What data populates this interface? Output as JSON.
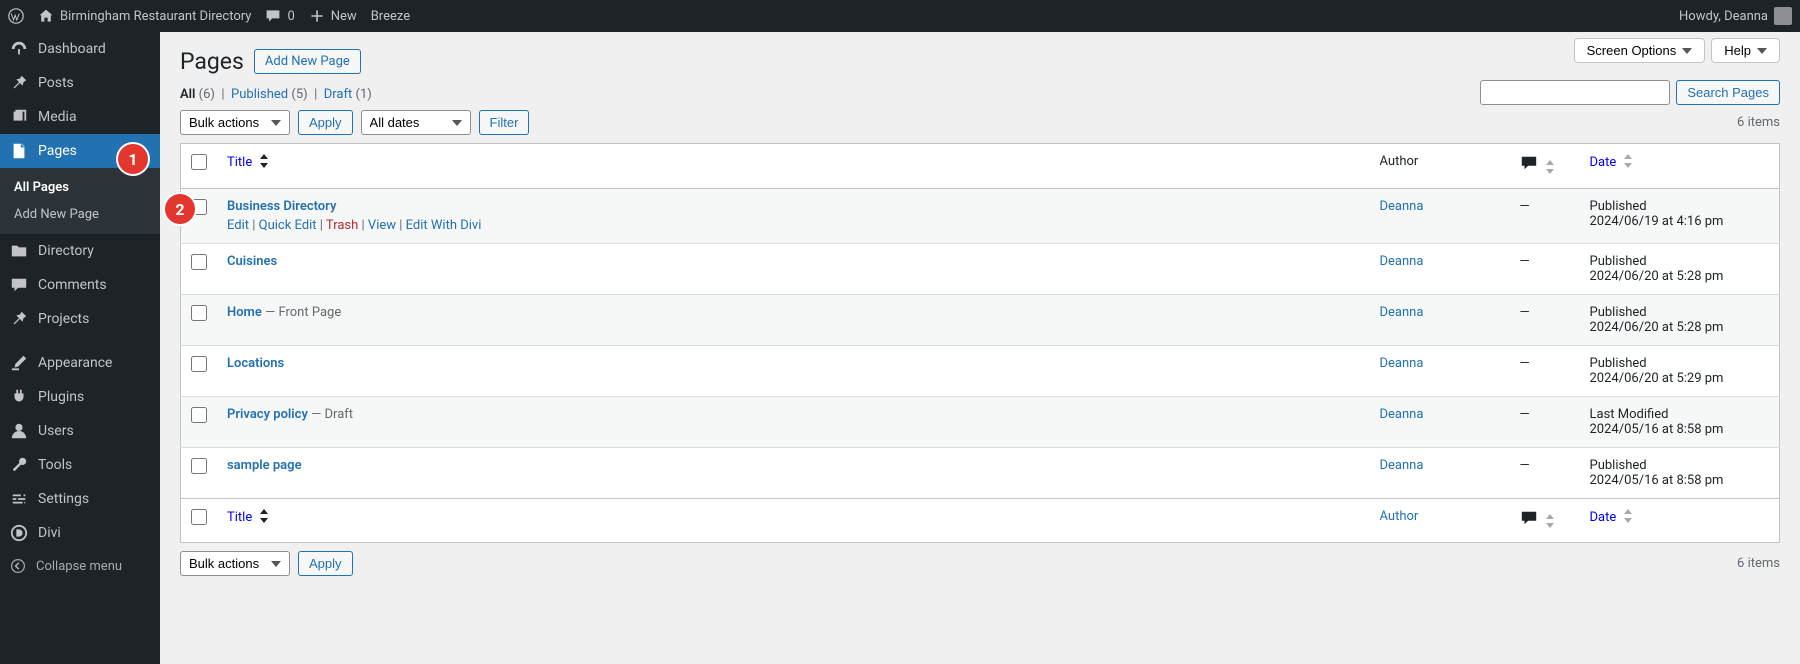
{
  "adminbar": {
    "site_title": "Birmingham Restaurant Directory",
    "comments_count": "0",
    "new_label": "New",
    "breeze_label": "Breeze",
    "howdy": "Howdy, Deanna"
  },
  "sidebar": {
    "items": [
      {
        "label": "Dashboard"
      },
      {
        "label": "Posts"
      },
      {
        "label": "Media"
      },
      {
        "label": "Pages"
      },
      {
        "label": "Directory"
      },
      {
        "label": "Comments"
      },
      {
        "label": "Projects"
      },
      {
        "label": "Appearance"
      },
      {
        "label": "Plugins"
      },
      {
        "label": "Users"
      },
      {
        "label": "Tools"
      },
      {
        "label": "Settings"
      },
      {
        "label": "Divi"
      }
    ],
    "sub": {
      "all_pages": "All Pages",
      "add_new": "Add New Page"
    },
    "collapse": "Collapse menu"
  },
  "screen": {
    "options": "Screen Options",
    "help": "Help"
  },
  "heading": "Pages",
  "add_new": "Add New Page",
  "filters": {
    "all": "All",
    "all_count": "(6)",
    "published": "Published",
    "published_count": "(5)",
    "draft": "Draft",
    "draft_count": "(1)"
  },
  "bulk": {
    "label": "Bulk actions",
    "apply": "Apply",
    "dates": "All dates",
    "filter": "Filter"
  },
  "search": {
    "button": "Search Pages"
  },
  "items_count": "6 items",
  "columns": {
    "title": "Title",
    "author": "Author",
    "date": "Date"
  },
  "row_actions": {
    "edit": "Edit",
    "quick_edit": "Quick Edit",
    "trash": "Trash",
    "view": "View",
    "edit_divi": "Edit With Divi"
  },
  "rows": [
    {
      "title": "Business Directory",
      "state": "",
      "author": "Deanna",
      "comments": "—",
      "date_status": "Published",
      "date_value": "2024/06/19 at 4:16 pm",
      "show_actions": true
    },
    {
      "title": "Cuisines",
      "state": "",
      "author": "Deanna",
      "comments": "—",
      "date_status": "Published",
      "date_value": "2024/06/20 at 5:28 pm"
    },
    {
      "title": "Home",
      "state": " — Front Page",
      "author": "Deanna",
      "comments": "—",
      "date_status": "Published",
      "date_value": "2024/06/20 at 5:28 pm"
    },
    {
      "title": "Locations",
      "state": "",
      "author": "Deanna",
      "comments": "—",
      "date_status": "Published",
      "date_value": "2024/06/20 at 5:29 pm"
    },
    {
      "title": "Privacy policy",
      "state": " — Draft",
      "author": "Deanna",
      "comments": "—",
      "date_status": "Last Modified",
      "date_value": "2024/05/16 at 8:58 pm"
    },
    {
      "title": "sample page",
      "state": "",
      "author": "Deanna",
      "comments": "—",
      "date_status": "Published",
      "date_value": "2024/05/16 at 8:58 pm"
    }
  ],
  "callouts": {
    "one": "1",
    "two": "2"
  }
}
